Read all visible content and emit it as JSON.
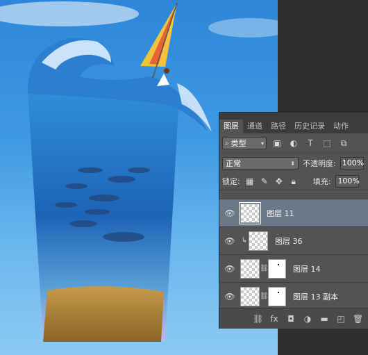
{
  "panel": {
    "tabs": [
      {
        "label": "图层",
        "active": true
      },
      {
        "label": "通道",
        "active": false
      },
      {
        "label": "路径",
        "active": false
      },
      {
        "label": "历史记录",
        "active": false
      },
      {
        "label": "动作",
        "active": false
      }
    ],
    "filter": {
      "kind_label": "类型",
      "search_icon": "search-icon"
    },
    "blend_mode": "正常",
    "opacity_label": "不透明度:",
    "opacity_value": "100%",
    "lock_label": "锁定:",
    "fill_label": "填充:",
    "fill_value": "100%",
    "layers": [
      {
        "name": "图层 11",
        "selected": true,
        "mask": false,
        "clipped": false
      },
      {
        "name": "图层 36",
        "selected": false,
        "mask": false,
        "clipped": true
      },
      {
        "name": "图层 14",
        "selected": false,
        "mask": true,
        "clipped": false
      },
      {
        "name": "图层 13 副本",
        "selected": false,
        "mask": true,
        "clipped": false
      }
    ]
  },
  "colors": {
    "sky_top": "#2e86d8",
    "panel_bg": "#535353",
    "selected_row": "#6b7888"
  }
}
